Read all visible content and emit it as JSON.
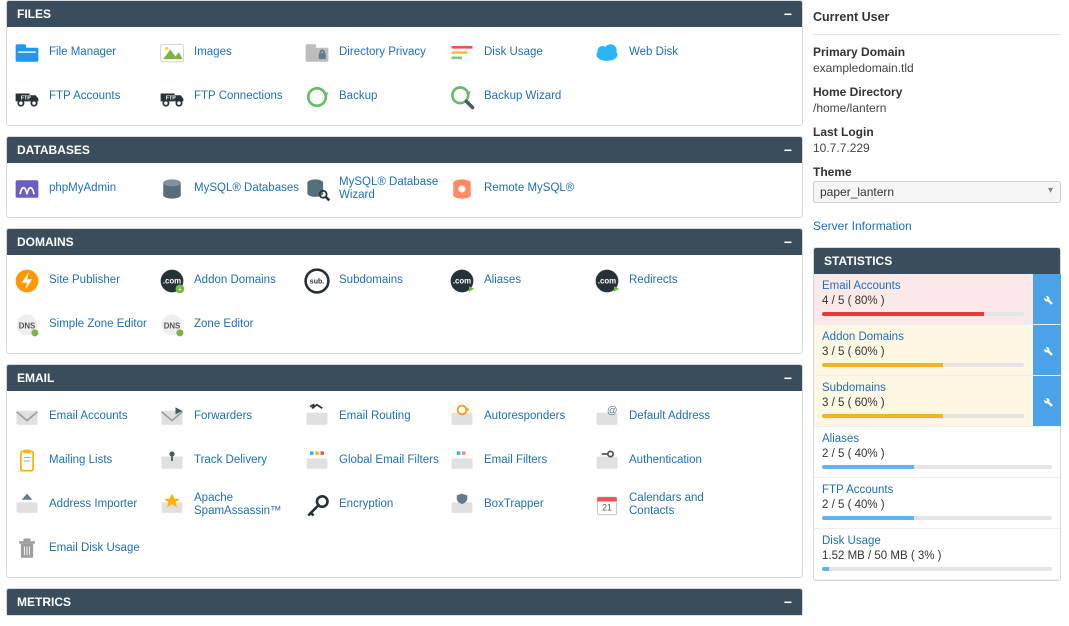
{
  "groups": [
    {
      "key": "files",
      "title": "FILES",
      "cols": 5,
      "items": [
        {
          "name": "file-manager",
          "label": "File Manager",
          "icon": "folder",
          "c": "#2196f3"
        },
        {
          "name": "images",
          "label": "Images",
          "icon": "image",
          "c": "#7cb342"
        },
        {
          "name": "directory-privacy",
          "label": "Directory Privacy",
          "icon": "lockfolder",
          "c": "#bdbdbd"
        },
        {
          "name": "disk-usage",
          "label": "Disk Usage",
          "icon": "bars",
          "c": "#ef5350"
        },
        {
          "name": "web-disk",
          "label": "Web Disk",
          "icon": "cloud",
          "c": "#29b6f6"
        },
        {
          "name": "ftp-accounts",
          "label": "FTP Accounts",
          "icon": "truck",
          "c": "#263238"
        },
        {
          "name": "ftp-connections",
          "label": "FTP Connections",
          "icon": "truck",
          "c": "#263238"
        },
        {
          "name": "backup",
          "label": "Backup",
          "icon": "refresh",
          "c": "#66bb6a"
        },
        {
          "name": "backup-wizard",
          "label": "Backup Wizard",
          "icon": "searchrefresh",
          "c": "#66bb6a"
        }
      ]
    },
    {
      "key": "databases",
      "title": "DATABASES",
      "cols": 5,
      "items": [
        {
          "name": "phpmyadmin",
          "label": "phpMyAdmin",
          "icon": "pma",
          "c": "#6a5fc1"
        },
        {
          "name": "mysql-db",
          "label": "MySQL® Databases",
          "icon": "db",
          "c": "#546e7a"
        },
        {
          "name": "mysql-wizard",
          "label": "MySQL® Database Wizard",
          "icon": "dbsearch",
          "c": "#546e7a"
        },
        {
          "name": "remote-mysql",
          "label": "Remote MySQL®",
          "icon": "dbremote",
          "c": "#ff8a65"
        }
      ]
    },
    {
      "key": "domains",
      "title": "DOMAINS",
      "cols": 5,
      "items": [
        {
          "name": "site-publisher",
          "label": "Site Publisher",
          "icon": "bolt",
          "c": "#ff9800"
        },
        {
          "name": "addon-domains",
          "label": "Addon Domains",
          "icon": "comadd",
          "c": "#263238"
        },
        {
          "name": "subdomains",
          "label": "Subdomains",
          "icon": "sub",
          "c": "#263238"
        },
        {
          "name": "aliases",
          "label": "Aliases",
          "icon": "comarrow",
          "c": "#263238"
        },
        {
          "name": "redirects",
          "label": "Redirects",
          "icon": "comarrow",
          "c": "#263238"
        },
        {
          "name": "simple-zone",
          "label": "Simple Zone Editor",
          "icon": "dns",
          "c": "#9e9e9e"
        },
        {
          "name": "zone-editor",
          "label": "Zone Editor",
          "icon": "dns",
          "c": "#9e9e9e"
        }
      ]
    },
    {
      "key": "email",
      "title": "EMAIL",
      "cols": 5,
      "items": [
        {
          "name": "email-accounts",
          "label": "Email Accounts",
          "icon": "mail",
          "c": "#9e9e9e"
        },
        {
          "name": "forwarders",
          "label": "Forwarders",
          "icon": "mailfwd",
          "c": "#9e9e9e"
        },
        {
          "name": "email-routing",
          "label": "Email Routing",
          "icon": "mailroute",
          "c": "#9e9e9e"
        },
        {
          "name": "autoresponders",
          "label": "Autoresponders",
          "icon": "mailauto",
          "c": "#ff9800"
        },
        {
          "name": "default-address",
          "label": "Default Address",
          "icon": "mailat",
          "c": "#9e9e9e"
        },
        {
          "name": "mailing-lists",
          "label": "Mailing Lists",
          "icon": "clipboard",
          "c": "#ffb300"
        },
        {
          "name": "track-delivery",
          "label": "Track Delivery",
          "icon": "mailpin",
          "c": "#9e9e9e"
        },
        {
          "name": "global-filters",
          "label": "Global Email Filters",
          "icon": "mailfilter",
          "c": "#29b6f6"
        },
        {
          "name": "email-filters",
          "label": "Email Filters",
          "icon": "mailfilter2",
          "c": "#ff8a65"
        },
        {
          "name": "authentication",
          "label": "Authentication",
          "icon": "mailkey",
          "c": "#9e9e9e"
        },
        {
          "name": "address-importer",
          "label": "Address Importer",
          "icon": "mailup",
          "c": "#9e9e9e"
        },
        {
          "name": "spamassassin",
          "label": "Apache SpamAssassin™",
          "icon": "spam",
          "c": "#ffb300"
        },
        {
          "name": "encryption",
          "label": "Encryption",
          "icon": "key",
          "c": "#263238"
        },
        {
          "name": "boxtrapper",
          "label": "BoxTrapper",
          "icon": "mailshield",
          "c": "#9e9e9e"
        },
        {
          "name": "calendars",
          "label": "Calendars and Contacts",
          "icon": "cal",
          "c": "#ef5350"
        },
        {
          "name": "email-disk",
          "label": "Email Disk Usage",
          "icon": "trash",
          "c": "#9e9e9e"
        }
      ]
    },
    {
      "key": "metrics",
      "title": "METRICS",
      "cols": 5,
      "items": []
    }
  ],
  "side": {
    "current_user": "Current User",
    "primary_domain_k": "Primary Domain",
    "primary_domain_v": "exampledomain.tld",
    "home_dir_k": "Home Directory",
    "home_dir_v": "/home/lantern",
    "last_login_k": "Last Login",
    "last_login_v": "10.7.7.229",
    "theme_k": "Theme",
    "theme_v": "paper_lantern",
    "server_info": "Server Information",
    "stats_title": "STATISTICS",
    "stats": [
      {
        "name": "email-accounts-stat",
        "label": "Email Accounts",
        "text": "4 / 5 ( 80% )",
        "pct": 80,
        "tone": "red",
        "wrench": true
      },
      {
        "name": "addon-domains-stat",
        "label": "Addon Domains",
        "text": "3 / 5 ( 60% )",
        "pct": 60,
        "tone": "yel",
        "wrench": true
      },
      {
        "name": "subdomains-stat",
        "label": "Subdomains",
        "text": "3 / 5 ( 60% )",
        "pct": 60,
        "tone": "yel",
        "wrench": true
      },
      {
        "name": "aliases-stat",
        "label": "Aliases",
        "text": "2 / 5 ( 40% )",
        "pct": 40,
        "tone": "plain",
        "wrench": false
      },
      {
        "name": "ftp-accounts-stat",
        "label": "FTP Accounts",
        "text": "2 / 5 ( 40% )",
        "pct": 40,
        "tone": "plain",
        "wrench": false
      },
      {
        "name": "disk-usage-stat",
        "label": "Disk Usage",
        "text": "1.52 MB / 50 MB ( 3% )",
        "pct": 3,
        "tone": "plain",
        "wrench": false
      }
    ]
  }
}
